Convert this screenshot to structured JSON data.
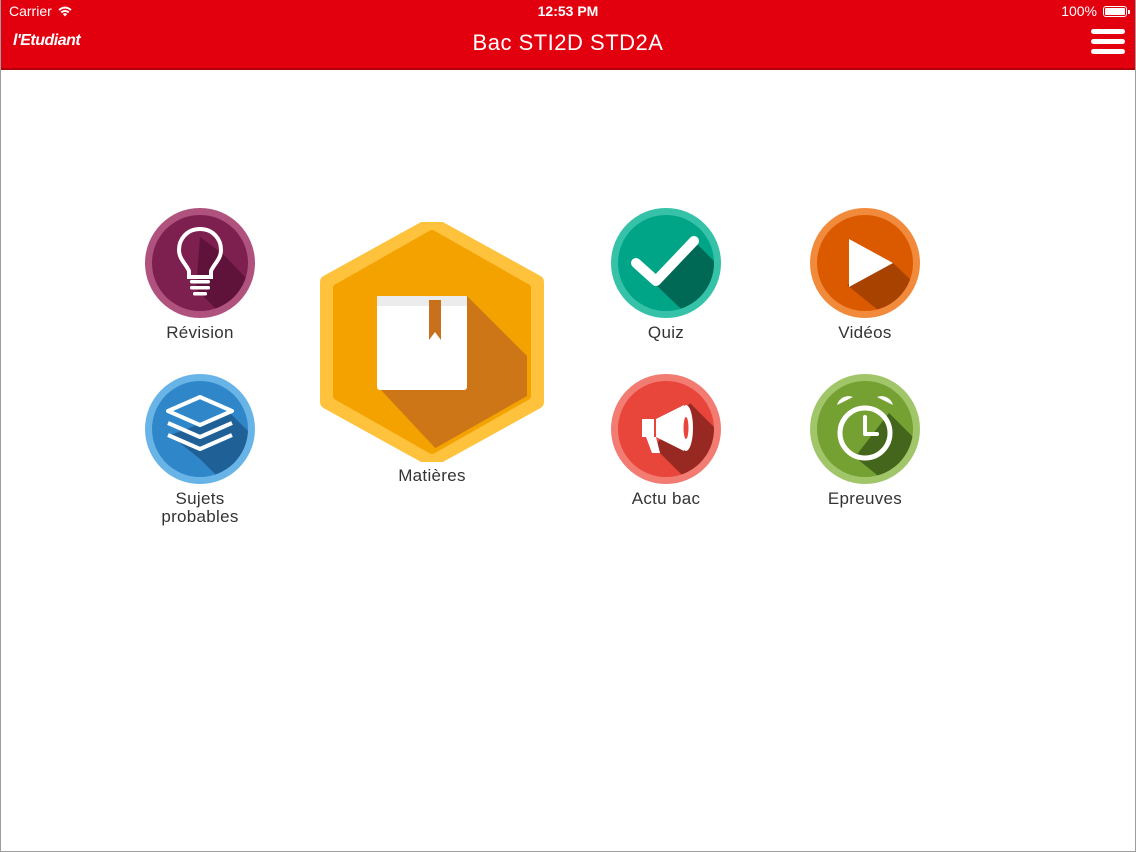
{
  "status_bar": {
    "carrier": "Carrier",
    "time": "12:53 PM",
    "battery": "100%",
    "battery_level": 1.0
  },
  "header": {
    "logo": "l'Etudiant",
    "title": "Bac STI2D STD2A",
    "menu_icon": "hamburger-menu-icon",
    "background_color": "#e2000f"
  },
  "tiles": {
    "revision": {
      "label": "Révision",
      "icon": "lightbulb-icon",
      "color": "#8e2a5a"
    },
    "sujets": {
      "label_line1": "Sujets",
      "label_line2": "probables",
      "icon": "layers-icon",
      "color": "#2f8ed0"
    },
    "matieres": {
      "label": "Matières",
      "icon": "book-icon",
      "color": "#f5a000"
    },
    "quiz": {
      "label": "Quiz",
      "icon": "checkmark-icon",
      "color": "#00a589"
    },
    "videos": {
      "label": "Vidéos",
      "icon": "play-icon",
      "color": "#e86a10"
    },
    "actu": {
      "label": "Actu bac",
      "icon": "megaphone-icon",
      "color": "#ea4b3e"
    },
    "epreuves": {
      "label": "Epreuves",
      "icon": "alarm-clock-icon",
      "color": "#7aa63a"
    }
  }
}
